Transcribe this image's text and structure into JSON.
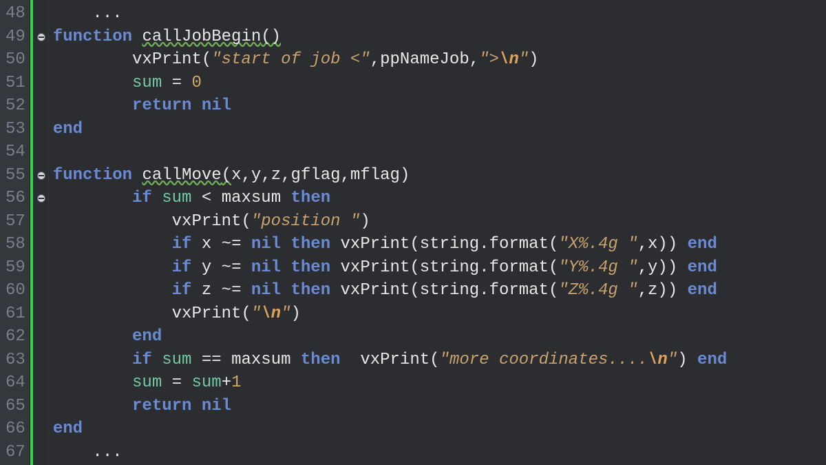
{
  "first_line_number": 48,
  "fold_markers": [
    49,
    55,
    56
  ],
  "lines": [
    {
      "indent": 1,
      "tokens": [
        [
          "punc",
          "..."
        ]
      ]
    },
    {
      "indent": 0,
      "tokens": [
        [
          "kw",
          "function"
        ],
        [
          "punc",
          " "
        ],
        [
          "fn",
          "callJobBegin"
        ],
        [
          "punc",
          "()"
        ]
      ],
      "warn_ranges": [
        [
          2,
          3
        ]
      ]
    },
    {
      "indent": 2,
      "tokens": [
        [
          "fn",
          "vxPrint"
        ],
        [
          "punc",
          "("
        ],
        [
          "str",
          "\"start of job <\""
        ],
        [
          "punc",
          ","
        ],
        [
          "fn",
          "ppNameJob"
        ],
        [
          "punc",
          ","
        ],
        [
          "str",
          "\">"
        ],
        [
          "esc",
          "\\n"
        ],
        [
          "str",
          "\""
        ],
        [
          "punc",
          ")"
        ]
      ]
    },
    {
      "indent": 2,
      "tokens": [
        [
          "global",
          "sum"
        ],
        [
          "punc",
          " = "
        ],
        [
          "num",
          "0"
        ]
      ]
    },
    {
      "indent": 2,
      "tokens": [
        [
          "kw",
          "return"
        ],
        [
          "punc",
          " "
        ],
        [
          "keyconst",
          "nil"
        ]
      ]
    },
    {
      "indent": 0,
      "tokens": [
        [
          "kw",
          "end"
        ]
      ]
    },
    {
      "indent": 0,
      "tokens": []
    },
    {
      "indent": 0,
      "tokens": [
        [
          "kw",
          "function"
        ],
        [
          "punc",
          " "
        ],
        [
          "fn",
          "callMove"
        ],
        [
          "punc",
          "("
        ],
        [
          "fn",
          "x"
        ],
        [
          "punc",
          ","
        ],
        [
          "fn",
          "y"
        ],
        [
          "punc",
          ","
        ],
        [
          "fn",
          "z"
        ],
        [
          "punc",
          ","
        ],
        [
          "fn",
          "gflag"
        ],
        [
          "punc",
          ","
        ],
        [
          "fn",
          "mflag"
        ],
        [
          "punc",
          ")"
        ]
      ],
      "warn_ranges": [
        [
          2,
          3
        ]
      ]
    },
    {
      "indent": 2,
      "tokens": [
        [
          "kw",
          "if"
        ],
        [
          "punc",
          " "
        ],
        [
          "global",
          "sum"
        ],
        [
          "punc",
          " < "
        ],
        [
          "fn",
          "maxsum"
        ],
        [
          "punc",
          " "
        ],
        [
          "kw",
          "then"
        ]
      ]
    },
    {
      "indent": 3,
      "tokens": [
        [
          "fn",
          "vxPrint"
        ],
        [
          "punc",
          "("
        ],
        [
          "str",
          "\"position \""
        ],
        [
          "punc",
          ")"
        ]
      ]
    },
    {
      "indent": 3,
      "tokens": [
        [
          "kw",
          "if"
        ],
        [
          "punc",
          " "
        ],
        [
          "fn",
          "x"
        ],
        [
          "punc",
          " ~= "
        ],
        [
          "keyconst",
          "nil"
        ],
        [
          "punc",
          " "
        ],
        [
          "kw",
          "then"
        ],
        [
          "punc",
          " "
        ],
        [
          "fn",
          "vxPrint"
        ],
        [
          "punc",
          "("
        ],
        [
          "builtin",
          "string.format"
        ],
        [
          "punc",
          "("
        ],
        [
          "str",
          "\"X%.4g \""
        ],
        [
          "punc",
          ","
        ],
        [
          "fn",
          "x"
        ],
        [
          "punc",
          "))"
        ],
        [
          "punc",
          " "
        ],
        [
          "kw",
          "end"
        ]
      ]
    },
    {
      "indent": 3,
      "tokens": [
        [
          "kw",
          "if"
        ],
        [
          "punc",
          " "
        ],
        [
          "fn",
          "y"
        ],
        [
          "punc",
          " ~= "
        ],
        [
          "keyconst",
          "nil"
        ],
        [
          "punc",
          " "
        ],
        [
          "kw",
          "then"
        ],
        [
          "punc",
          " "
        ],
        [
          "fn",
          "vxPrint"
        ],
        [
          "punc",
          "("
        ],
        [
          "builtin",
          "string.format"
        ],
        [
          "punc",
          "("
        ],
        [
          "str",
          "\"Y%.4g \""
        ],
        [
          "punc",
          ","
        ],
        [
          "fn",
          "y"
        ],
        [
          "punc",
          "))"
        ],
        [
          "punc",
          " "
        ],
        [
          "kw",
          "end"
        ]
      ]
    },
    {
      "indent": 3,
      "tokens": [
        [
          "kw",
          "if"
        ],
        [
          "punc",
          " "
        ],
        [
          "fn",
          "z"
        ],
        [
          "punc",
          " ~= "
        ],
        [
          "keyconst",
          "nil"
        ],
        [
          "punc",
          " "
        ],
        [
          "kw",
          "then"
        ],
        [
          "punc",
          " "
        ],
        [
          "fn",
          "vxPrint"
        ],
        [
          "punc",
          "("
        ],
        [
          "builtin",
          "string.format"
        ],
        [
          "punc",
          "("
        ],
        [
          "str",
          "\"Z%.4g \""
        ],
        [
          "punc",
          ","
        ],
        [
          "fn",
          "z"
        ],
        [
          "punc",
          "))"
        ],
        [
          "punc",
          " "
        ],
        [
          "kw",
          "end"
        ]
      ]
    },
    {
      "indent": 3,
      "tokens": [
        [
          "fn",
          "vxPrint"
        ],
        [
          "punc",
          "("
        ],
        [
          "str",
          "\""
        ],
        [
          "esc",
          "\\n"
        ],
        [
          "str",
          "\""
        ],
        [
          "punc",
          ")"
        ]
      ]
    },
    {
      "indent": 2,
      "tokens": [
        [
          "kw",
          "end"
        ]
      ]
    },
    {
      "indent": 2,
      "tokens": [
        [
          "kw",
          "if"
        ],
        [
          "punc",
          " "
        ],
        [
          "global",
          "sum"
        ],
        [
          "punc",
          " == "
        ],
        [
          "fn",
          "maxsum"
        ],
        [
          "punc",
          " "
        ],
        [
          "kw",
          "then"
        ],
        [
          "punc",
          "  "
        ],
        [
          "fn",
          "vxPrint"
        ],
        [
          "punc",
          "("
        ],
        [
          "str",
          "\"more coordinates...."
        ],
        [
          "esc",
          "\\n"
        ],
        [
          "str",
          "\""
        ],
        [
          "punc",
          ")"
        ],
        [
          "punc",
          " "
        ],
        [
          "kw",
          "end"
        ]
      ]
    },
    {
      "indent": 2,
      "tokens": [
        [
          "global",
          "sum"
        ],
        [
          "punc",
          " = "
        ],
        [
          "global",
          "sum"
        ],
        [
          "punc",
          "+"
        ],
        [
          "num",
          "1"
        ]
      ]
    },
    {
      "indent": 2,
      "tokens": [
        [
          "kw",
          "return"
        ],
        [
          "punc",
          " "
        ],
        [
          "keyconst",
          "nil"
        ]
      ]
    },
    {
      "indent": 0,
      "tokens": [
        [
          "kw",
          "end"
        ]
      ]
    },
    {
      "indent": 1,
      "tokens": [
        [
          "punc",
          "..."
        ]
      ]
    }
  ]
}
